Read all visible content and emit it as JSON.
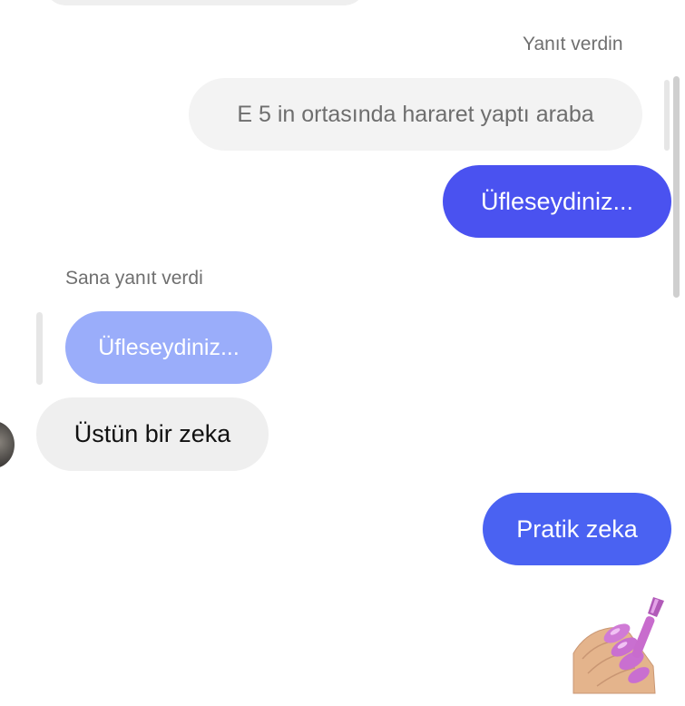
{
  "thread": {
    "you_replied_label": "Yanıt verdin",
    "they_replied_label": "Sana yanıt verdi"
  },
  "messages": [
    {
      "id": "quoted-own",
      "text": "E 5 in ortasında hararet yaptı araba",
      "side": "right",
      "style": "quoted"
    },
    {
      "id": "sent-1",
      "text": "Üfleseydiniz...",
      "side": "right",
      "style": "sent"
    },
    {
      "id": "quoted-incoming",
      "text": "Üfleseydiniz...",
      "side": "left",
      "style": "quoted"
    },
    {
      "id": "received-1",
      "text": "Üstün bir zeka",
      "side": "left",
      "style": "received"
    },
    {
      "id": "sent-2",
      "text": "Pratik zeka",
      "side": "right",
      "style": "sent"
    },
    {
      "id": "sent-3",
      "emoji": "nail-polish-emoji",
      "side": "right",
      "style": "emoji"
    }
  ],
  "colors": {
    "sent_bubble": "#4a52f0",
    "sent_bubble_2": "#4a62f2",
    "received_bubble": "#efefef",
    "quoted_bubble": "#f3f3f3",
    "quoted_incoming_bubble": "#9aadfa"
  }
}
